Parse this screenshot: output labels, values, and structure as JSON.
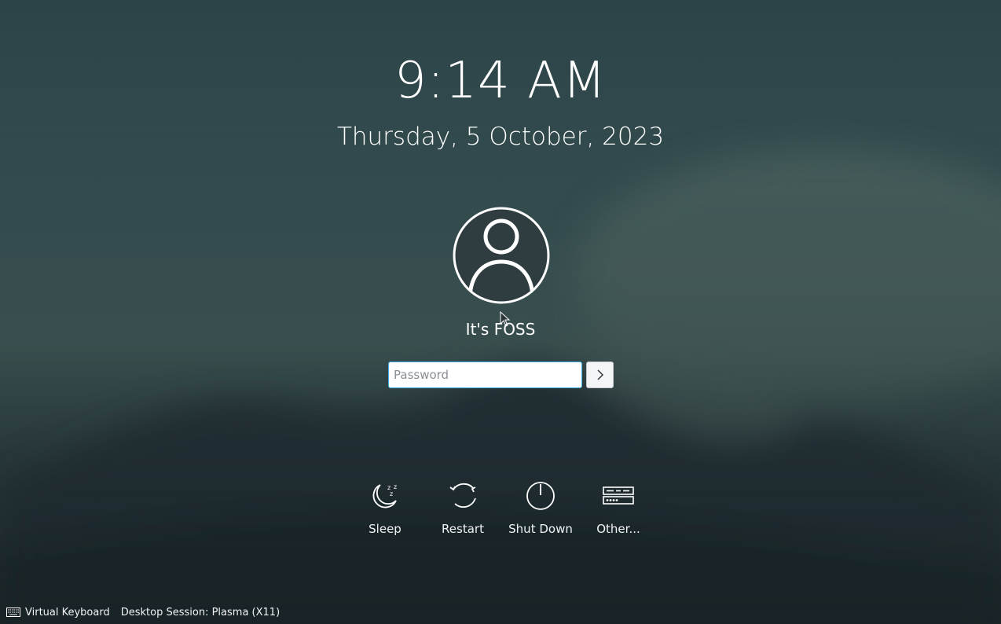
{
  "clock": {
    "time": "9:14 AM",
    "date": "Thursday, 5 October, 2023"
  },
  "user": {
    "name": "It's FOSS",
    "avatar_icon": "user-avatar-icon"
  },
  "login": {
    "password_placeholder": "Password",
    "submit_icon": "chevron-right-icon"
  },
  "actions": [
    {
      "label": "Sleep",
      "icon": "sleep-icon"
    },
    {
      "label": "Restart",
      "icon": "restart-icon"
    },
    {
      "label": "Shut Down",
      "icon": "power-icon"
    },
    {
      "label": "Other...",
      "icon": "switch-user-icon"
    }
  ],
  "footer": {
    "virtual_keyboard": "Virtual Keyboard",
    "desktop_session": "Desktop Session: Plasma (X11)"
  },
  "colors": {
    "accent": "#3daee9",
    "background": "#3b5658",
    "text": "#ffffff"
  }
}
